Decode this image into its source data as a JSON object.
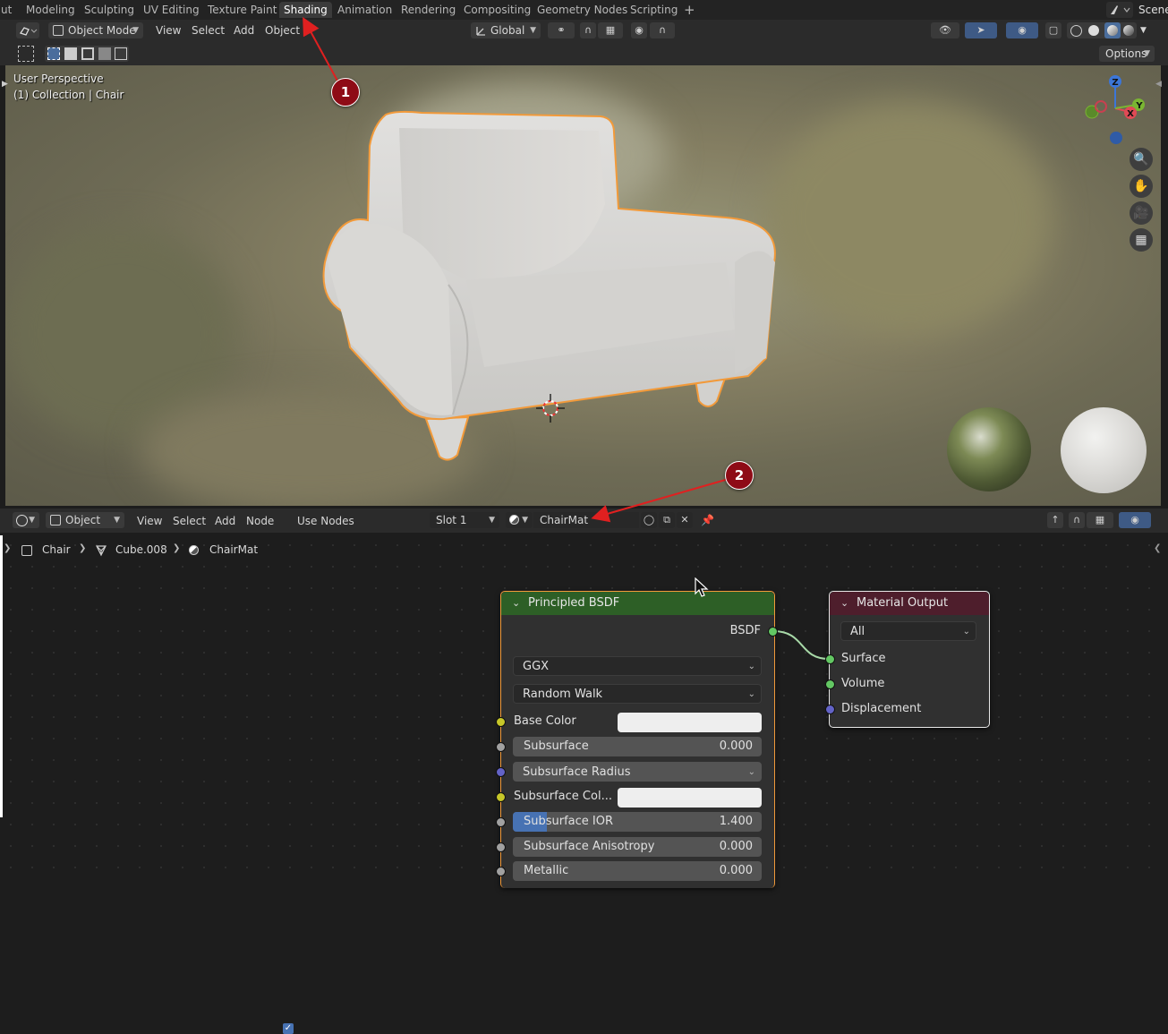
{
  "workspace_tabs": [
    "ut",
    "Modeling",
    "Sculpting",
    "UV Editing",
    "Texture Paint",
    "Shading",
    "Animation",
    "Rendering",
    "Compositing",
    "Geometry Nodes",
    "Scripting",
    "+"
  ],
  "active_tab": "Shading",
  "scene_label": "Scene",
  "viewport_header": {
    "mode": "Object Mode",
    "menus": [
      "View",
      "Select",
      "Add",
      "Object"
    ],
    "orientation": "Global"
  },
  "viewport_tools": {
    "options_label": "Options"
  },
  "viewport": {
    "perspective_label": "User Perspective",
    "collection_label": "(1) Collection | Chair",
    "gizmo": {
      "z": "Z",
      "y": "Y",
      "x": "X"
    }
  },
  "annotations": {
    "m1": "1",
    "m2": "2"
  },
  "node_header": {
    "editor_type": "Object",
    "menus": [
      "View",
      "Select",
      "Add",
      "Node"
    ],
    "use_nodes_label": "Use Nodes",
    "use_nodes_checked": true,
    "slot": "Slot 1",
    "material": "ChairMat"
  },
  "breadcrumb": {
    "object": "Chair",
    "mesh": "Cube.008",
    "material": "ChairMat"
  },
  "principled_node": {
    "title": "Principled BSDF",
    "output": "BSDF",
    "distribution": "GGX",
    "subsurface_method": "Random Walk",
    "inputs": {
      "base_color": "Base Color",
      "subsurface": {
        "label": "Subsurface",
        "value": "0.000"
      },
      "subsurface_radius": "Subsurface Radius",
      "subsurface_color": "Subsurface Col...",
      "subsurface_ior": {
        "label": "Subsurface IOR",
        "value": "1.400"
      },
      "subsurface_anisotropy": {
        "label": "Subsurface Anisotropy",
        "value": "0.000"
      },
      "metallic": {
        "label": "Metallic",
        "value": "0.000"
      }
    }
  },
  "output_node": {
    "title": "Material Output",
    "target": "All",
    "inputs": [
      "Surface",
      "Volume",
      "Displacement"
    ]
  },
  "colors": {
    "principled_header": "#2d5f26",
    "output_header": "#4e1e2c",
    "selected_outline": "#f29a3a",
    "shader_socket": "#63c763",
    "color_socket": "#c7c729",
    "float_socket": "#a1a1a1",
    "vector_socket": "#6363c7",
    "annotation_red": "#8e0b16"
  }
}
